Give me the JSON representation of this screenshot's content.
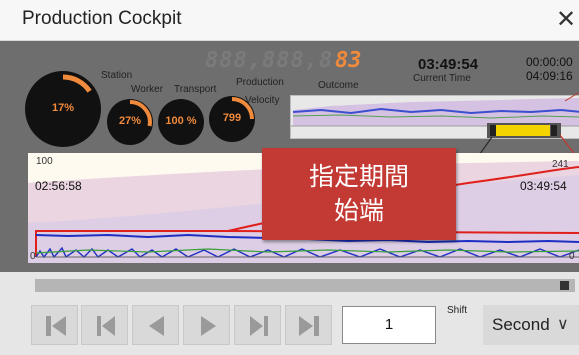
{
  "window": {
    "title": "Production Cockpit"
  },
  "gauges": {
    "station": {
      "label": "Station",
      "value_text": "17%",
      "fraction": 0.17
    },
    "worker": {
      "label": "Worker",
      "value_text": "27%",
      "fraction": 0.27
    },
    "transport": {
      "label": "Transport",
      "value_text": "100 %",
      "fraction": 1.0
    },
    "velocity": {
      "label_line1": "Production",
      "label_line2": "Velocity",
      "value_text": "799",
      "fraction": 0.33
    }
  },
  "outcome": {
    "inactive_digits": "888,888,8",
    "value": "83",
    "label": "Outcome"
  },
  "current_time": {
    "value": "03:49:54",
    "label": "Current Time"
  },
  "clip_times": {
    "start": "00:00:00",
    "end": "04:09:16"
  },
  "chart": {
    "y_max_left": "100",
    "y_max_right": "241",
    "y_min_left": "0",
    "y_min_right": "0",
    "time_start": "02:56:58",
    "time_end": "03:49:54"
  },
  "callout": {
    "line1": "指定期間",
    "line2": "始端"
  },
  "navigation": {
    "first_icon": "skip-to-first-icon",
    "prev_page_icon": "previous-page-icon",
    "step_back_icon": "step-back-icon",
    "play_icon": "play-icon",
    "next_page_icon": "next-page-icon",
    "last_icon": "skip-to-last-icon",
    "page_value": "1",
    "shift_label": "Shift",
    "unit_value": "Second"
  },
  "colors": {
    "accent": "#f08a3c",
    "callout": "#c23a33",
    "series_red": "#e0201c",
    "series_blue": "#1f2fc4",
    "series_green": "#3aa13a",
    "overview_highlight": "#f3d400",
    "button_icon": "#9a9a9a"
  }
}
